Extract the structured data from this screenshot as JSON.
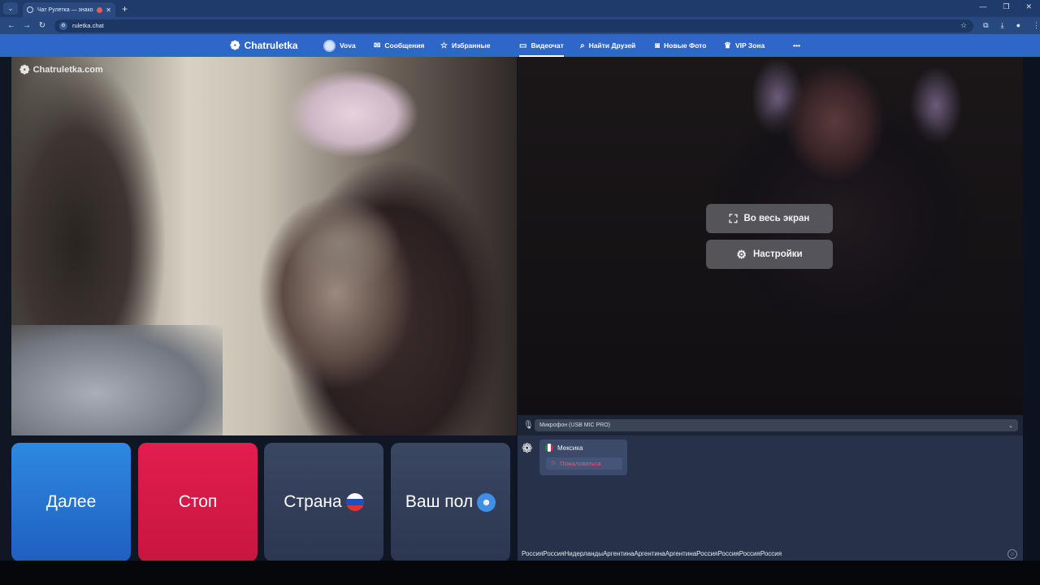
{
  "browser": {
    "tab_title": "Чат Рулетка — знакомства",
    "tab_close": "✕",
    "new_tab": "+",
    "url": "ruletka.chat",
    "window_controls": [
      "—",
      "❐",
      "✕"
    ]
  },
  "header": {
    "logo_text": "Chatruletka",
    "nav": [
      {
        "label": "Vova"
      },
      {
        "label": "Сообщения",
        "icon": "mail-icon"
      },
      {
        "label": "Избранные",
        "icon": "star-icon"
      },
      {
        "label": "Видеочат",
        "icon": "video-icon",
        "active": true
      },
      {
        "label": "Найти Друзей",
        "icon": "search-icon"
      },
      {
        "label": "Новые Фото",
        "icon": "camera-icon"
      },
      {
        "label": "VIP Зона",
        "icon": "crown-icon"
      },
      {
        "label": "•••",
        "icon": "more-icon"
      }
    ]
  },
  "partner_video": {
    "watermark": "Chatruletka.com"
  },
  "self_video": {
    "fullscreen_label": "Во весь экран",
    "settings_label": "Настройки"
  },
  "mic": {
    "selected": "Микрофон (USB MIC PRO)"
  },
  "controls": {
    "next_label": "Далее",
    "stop_label": "Стоп",
    "country_label": "Страна",
    "gender_label": "Ваш пол"
  },
  "chat": {
    "partner_country": "Мексика",
    "report_label": "Пожаловаться",
    "ticker": "РоссияРоссияНидерландыАргентинаАргентинаАргентинаРоссияРоссияРоссияРоссия"
  },
  "colors": {
    "brand_blue": "#2f67c9",
    "next_button": "#2676d4",
    "stop_button": "#d81a48",
    "report_red": "#e85a6a"
  }
}
